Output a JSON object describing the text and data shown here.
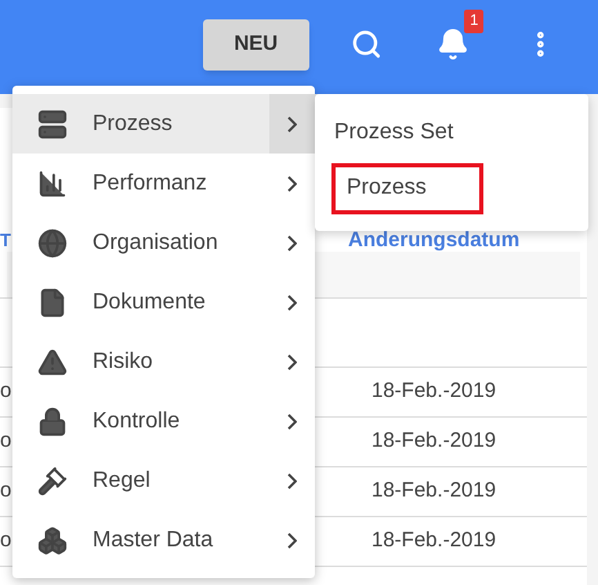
{
  "header": {
    "new_button": "NEU",
    "notification_count": "1"
  },
  "table": {
    "columns": [
      "T",
      "Anderungsdatum"
    ],
    "rows": [
      {
        "column_1": "o",
        "date": "18-Feb.-2019"
      },
      {
        "column_1": "o",
        "date": "18-Feb.-2019"
      },
      {
        "column_1": "o",
        "date": "18-Feb.-2019"
      },
      {
        "column_1": "o",
        "date": "18-Feb.-2019"
      }
    ]
  },
  "menu": {
    "items": [
      {
        "label": "Prozess",
        "selected": true
      },
      {
        "label": "Performanz",
        "selected": false
      },
      {
        "label": "Organisation",
        "selected": false
      },
      {
        "label": "Dokumente",
        "selected": false
      },
      {
        "label": "Risiko",
        "selected": false
      },
      {
        "label": "Kontrolle",
        "selected": false
      },
      {
        "label": "Regel",
        "selected": false
      },
      {
        "label": "Master Data",
        "selected": false
      }
    ]
  },
  "submenu": {
    "items": [
      {
        "label": "Prozess Set",
        "highlighted": false
      },
      {
        "label": "Prozess",
        "highlighted": true
      }
    ]
  }
}
